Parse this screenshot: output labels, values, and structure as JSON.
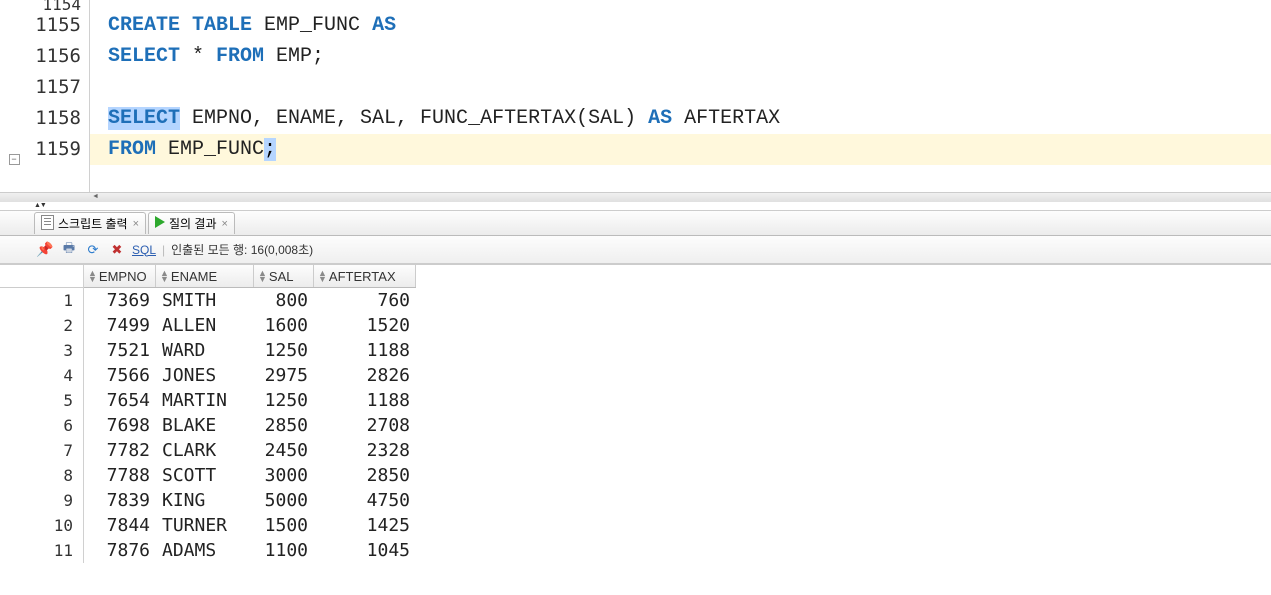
{
  "editor": {
    "lines": [
      {
        "num": "1154",
        "segments": []
      },
      {
        "num": "1155",
        "segments": [
          {
            "cls": "kw",
            "t": "CREATE TABLE"
          },
          {
            "cls": "txt",
            "t": " EMP_FUNC "
          },
          {
            "cls": "kw",
            "t": "AS"
          }
        ]
      },
      {
        "num": "1156",
        "segments": [
          {
            "cls": "kw",
            "t": "SELECT"
          },
          {
            "cls": "txt",
            "t": " * "
          },
          {
            "cls": "kw",
            "t": "FROM"
          },
          {
            "cls": "txt",
            "t": " EMP;"
          }
        ]
      },
      {
        "num": "1157",
        "segments": []
      },
      {
        "num": "1158",
        "segments": [
          {
            "cls": "kw-sel",
            "t": "SELECT"
          },
          {
            "cls": "txt",
            "t": " EMPNO, ENAME, SAL, FUNC_AFTERTAX(SAL) "
          },
          {
            "cls": "kw",
            "t": "AS"
          },
          {
            "cls": "txt",
            "t": " AFTERTAX"
          }
        ]
      },
      {
        "num": "1159",
        "current": true,
        "segments": [
          {
            "cls": "kw",
            "t": "FROM"
          },
          {
            "cls": "txt",
            "t": " EMP_FUNC"
          },
          {
            "cls": "semi-hl",
            "t": ";"
          }
        ]
      }
    ]
  },
  "tabs": {
    "script_output": "스크립트 출력",
    "query_result": "질의 결과"
  },
  "toolbar": {
    "sql_label": "SQL",
    "status": "인출된 모든 행: 16(0,008초)"
  },
  "grid": {
    "columns": [
      "EMPNO",
      "ENAME",
      "SAL",
      "AFTERTAX"
    ],
    "rows": [
      {
        "n": "1",
        "empno": "7369",
        "ename": "SMITH",
        "sal": "800",
        "aftertax": "760"
      },
      {
        "n": "2",
        "empno": "7499",
        "ename": "ALLEN",
        "sal": "1600",
        "aftertax": "1520"
      },
      {
        "n": "3",
        "empno": "7521",
        "ename": "WARD",
        "sal": "1250",
        "aftertax": "1188"
      },
      {
        "n": "4",
        "empno": "7566",
        "ename": "JONES",
        "sal": "2975",
        "aftertax": "2826"
      },
      {
        "n": "5",
        "empno": "7654",
        "ename": "MARTIN",
        "sal": "1250",
        "aftertax": "1188"
      },
      {
        "n": "6",
        "empno": "7698",
        "ename": "BLAKE",
        "sal": "2850",
        "aftertax": "2708"
      },
      {
        "n": "7",
        "empno": "7782",
        "ename": "CLARK",
        "sal": "2450",
        "aftertax": "2328"
      },
      {
        "n": "8",
        "empno": "7788",
        "ename": "SCOTT",
        "sal": "3000",
        "aftertax": "2850"
      },
      {
        "n": "9",
        "empno": "7839",
        "ename": "KING",
        "sal": "5000",
        "aftertax": "4750"
      },
      {
        "n": "10",
        "empno": "7844",
        "ename": "TURNER",
        "sal": "1500",
        "aftertax": "1425"
      },
      {
        "n": "11",
        "empno": "7876",
        "ename": "ADAMS",
        "sal": "1100",
        "aftertax": "1045"
      }
    ]
  }
}
